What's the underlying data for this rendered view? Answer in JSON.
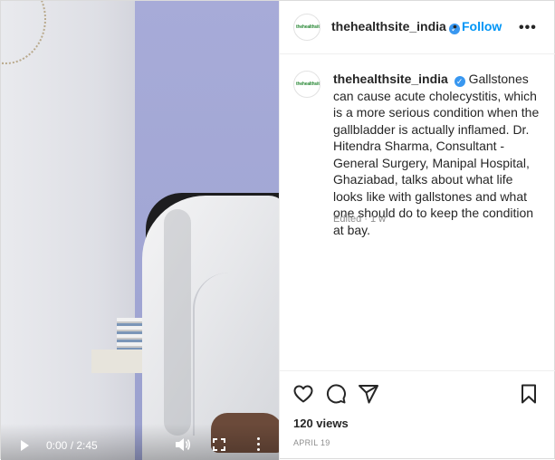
{
  "video": {
    "time_display": "0:00 / 2:45",
    "icons": [
      "play-icon",
      "volume-icon",
      "fullscreen-icon",
      "more-vertical-icon"
    ]
  },
  "header": {
    "avatar_text": "thehealthsite",
    "username": "thehealthsite_india",
    "verified_mark": "✓",
    "separator": "•",
    "follow_label": "Follow",
    "options_label": "•••"
  },
  "caption": {
    "username": "thehealthsite_india",
    "verified_mark": "✓",
    "text": "Gallstones can cause acute cholecystitis, which is a more serious condition when the gallbladder is actually inflamed. Dr. Hitendra Sharma, Consultant - General Surgery, Manipal Hospital, Ghaziabad, talks about what life looks like with gallstones and what one should do to keep the condition at bay.",
    "edited": "Edited · 1 w"
  },
  "actions": {
    "icons": [
      "heart-icon",
      "comment-icon",
      "share-icon",
      "bookmark-icon"
    ],
    "views": "120 views",
    "date": "APRIL 19"
  },
  "colors": {
    "link_blue": "#0095f6",
    "verified_blue": "#3897f0",
    "muted_text": "#8e8e8e"
  }
}
